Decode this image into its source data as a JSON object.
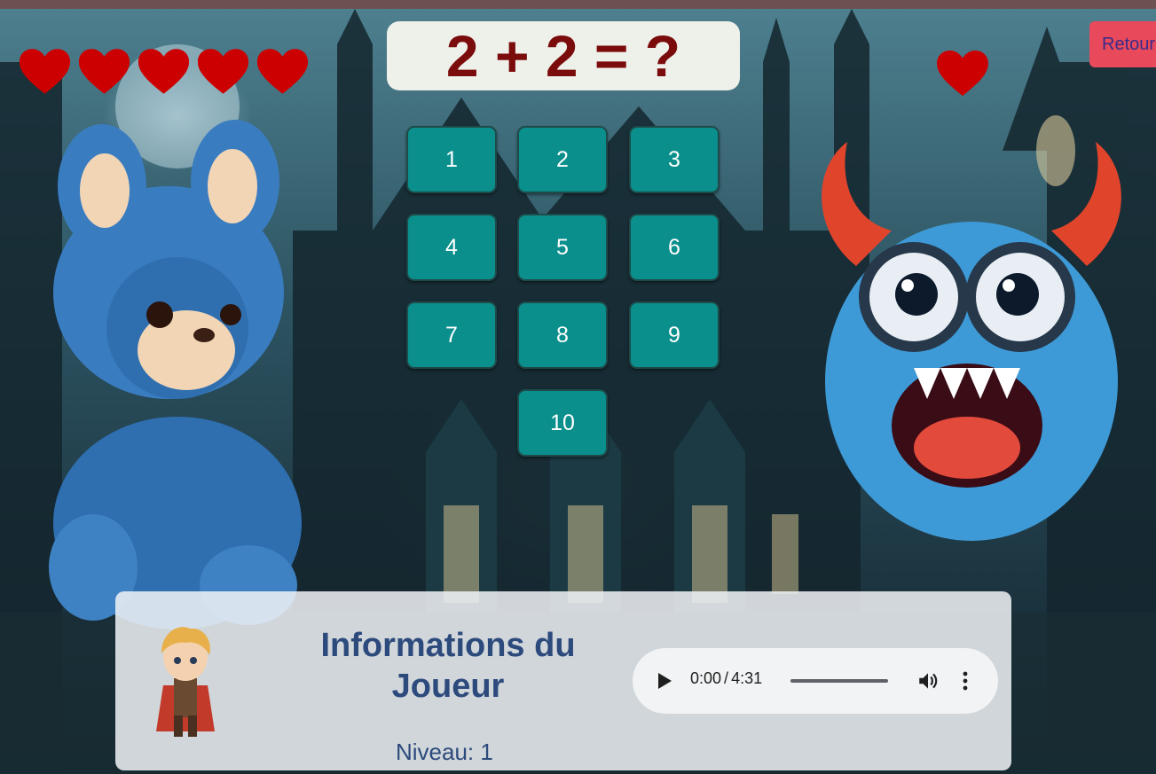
{
  "game": {
    "question": "2 + 2 = ?",
    "player_lives": 5,
    "enemy_lives": 1,
    "back_label": "Retour",
    "answers": [
      "1",
      "2",
      "3",
      "4",
      "5",
      "6",
      "7",
      "8",
      "9",
      "10"
    ]
  },
  "player_info": {
    "title": "Informations du Joueur",
    "level_label": "Niveau:",
    "level_value": "1"
  },
  "audio": {
    "current_time": "0:00",
    "separator": "/",
    "duration": "4:31",
    "progress_fraction": 0
  },
  "colors": {
    "heart": "#cc0000",
    "answer_button": "#0a8f8c",
    "question_text": "#7a0c0c",
    "back_button": "#e84a5c",
    "info_text": "#2c4a7c"
  },
  "icons": {
    "player_life": "heart-icon",
    "enemy_life": "heart-icon",
    "play": "play-icon",
    "volume": "volume-icon",
    "menu": "more-vert-icon"
  }
}
